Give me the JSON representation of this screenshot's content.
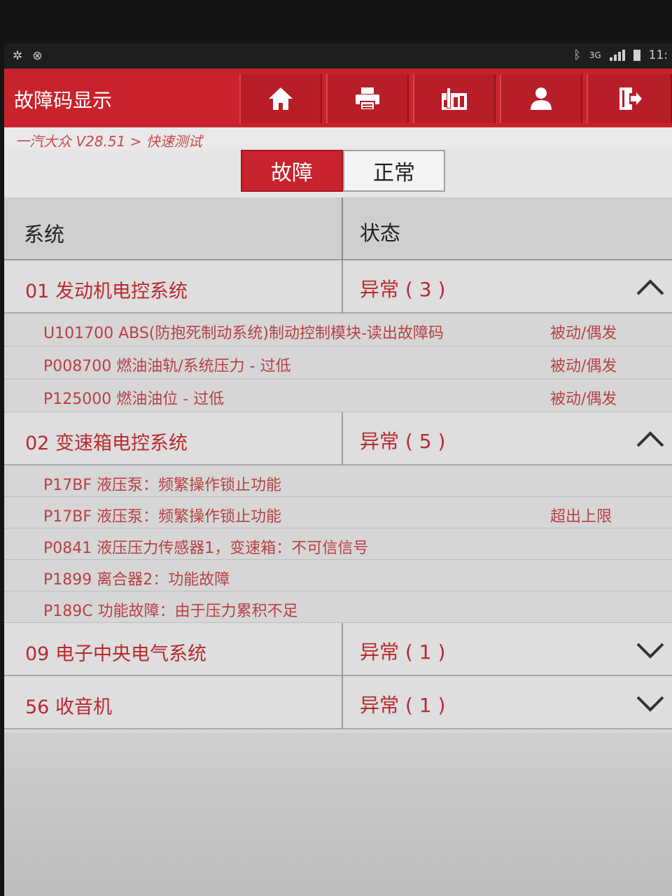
{
  "statusbar": {
    "left_icons": [
      "android-debug-icon",
      "usb-icon"
    ],
    "bluetooth": "bluetooth-icon",
    "network": "3G",
    "time": "11:"
  },
  "header": {
    "title": "故障码显示",
    "buttons": [
      {
        "name": "home-button",
        "icon": "home-icon"
      },
      {
        "name": "print-button",
        "icon": "printer-icon"
      },
      {
        "name": "report-button",
        "icon": "report-icon"
      },
      {
        "name": "user-button",
        "icon": "user-icon"
      },
      {
        "name": "exit-button",
        "icon": "exit-icon"
      }
    ]
  },
  "breadcrumb": "一汽大众 V28.51 > 快速测试",
  "tabs": {
    "fault": "故障",
    "normal": "正常",
    "active": "fault"
  },
  "table": {
    "col_system": "系统",
    "col_status": "状态",
    "systems": [
      {
        "name": "01 发动机电控系统",
        "status": "异常 ( 3 )",
        "expanded": true,
        "codes": [
          {
            "desc": "U101700 ABS(防抱死制动系统)制动控制模块-读出故障码",
            "status": "被动/偶发"
          },
          {
            "desc": "P008700 燃油油轨/系统压力 - 过低",
            "status": "被动/偶发"
          },
          {
            "desc": "P125000 燃油油位 - 过低",
            "status": "被动/偶发"
          }
        ]
      },
      {
        "name": "02 变速箱电控系统",
        "status": "异常 ( 5 )",
        "expanded": true,
        "codes": [
          {
            "desc": "P17BF 液压泵：频繁操作锁止功能",
            "status": ""
          },
          {
            "desc": "P17BF 液压泵：频繁操作锁止功能",
            "status": "超出上限"
          },
          {
            "desc": "P0841 液压压力传感器1，变速箱：不可信信号",
            "status": ""
          },
          {
            "desc": "P1899 离合器2：功能故障",
            "status": ""
          },
          {
            "desc": "P189C 功能故障：由于压力累积不足",
            "status": ""
          }
        ]
      },
      {
        "name": "09 电子中央电气系统",
        "status": "异常 ( 1 )",
        "expanded": false,
        "codes": []
      },
      {
        "name": "56 收音机",
        "status": "异常 ( 1 )",
        "expanded": false,
        "codes": []
      }
    ]
  },
  "colors": {
    "accent": "#c8232c",
    "text_red": "#b82a2f",
    "bg": "#d9d9d9"
  }
}
